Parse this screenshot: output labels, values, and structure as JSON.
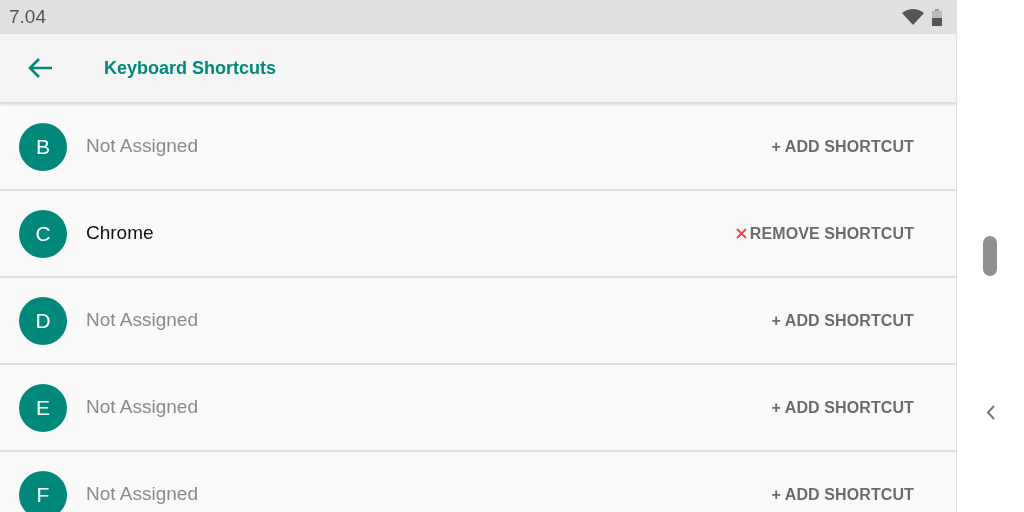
{
  "status_bar": {
    "time": "7.04"
  },
  "toolbar": {
    "title": "Keyboard Shortcuts"
  },
  "shortcuts": [
    {
      "letter": "B",
      "app": "Not Assigned",
      "assigned": false,
      "action": "+ ADD SHORTCUT"
    },
    {
      "letter": "C",
      "app": "Chrome",
      "assigned": true,
      "action": "REMOVE SHORTCUT"
    },
    {
      "letter": "D",
      "app": "Not Assigned",
      "assigned": false,
      "action": "+ ADD SHORTCUT"
    },
    {
      "letter": "E",
      "app": "Not Assigned",
      "assigned": false,
      "action": "+ ADD SHORTCUT"
    },
    {
      "letter": "F",
      "app": "Not Assigned",
      "assigned": false,
      "action": "+ ADD SHORTCUT"
    }
  ]
}
